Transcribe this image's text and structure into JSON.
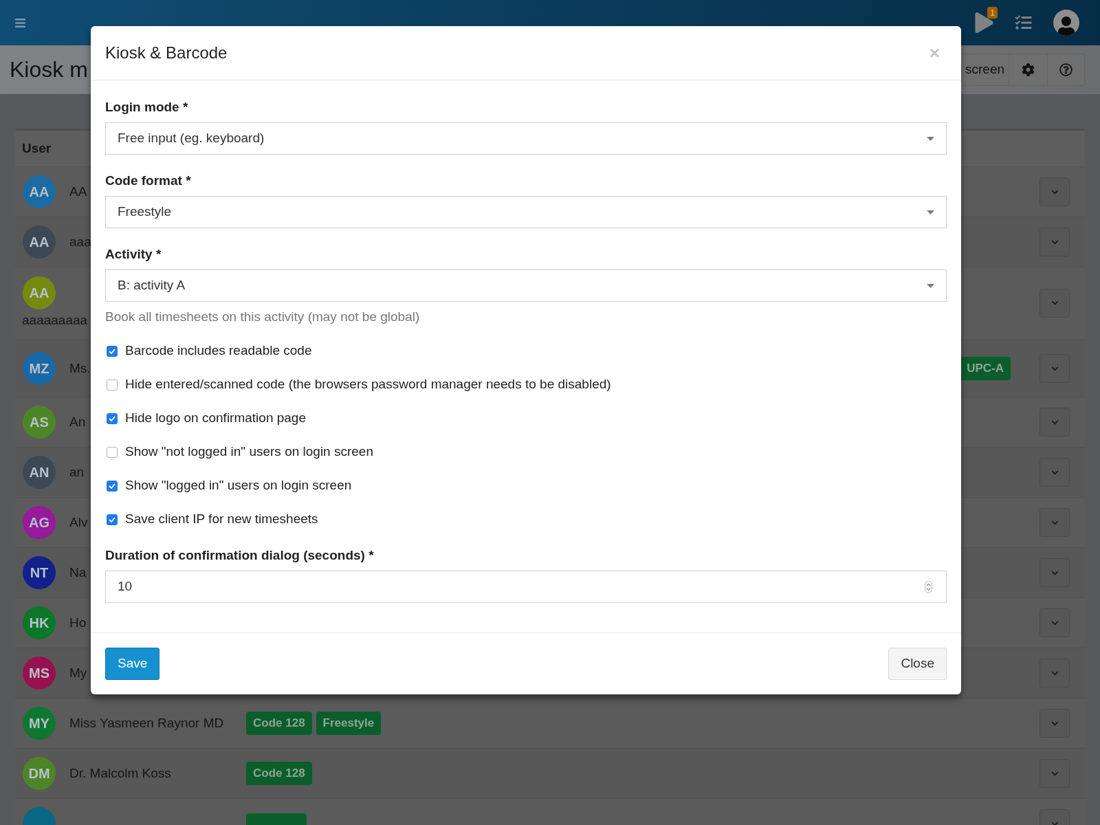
{
  "header": {
    "notification_count": "1"
  },
  "page": {
    "title": "Kiosk m",
    "toolbar_label": "screen"
  },
  "table": {
    "columns": [
      "User"
    ],
    "rows": [
      {
        "kind": "inline",
        "initials": "AA",
        "color": "#1c6ba3",
        "name": "AA"
      },
      {
        "kind": "inline",
        "initials": "AA",
        "color": "#3c4955",
        "name": "aaa"
      },
      {
        "kind": "wrapped",
        "initials": "AA",
        "color": "#778a10",
        "name": "aaaaaaaaa"
      },
      {
        "kind": "inline",
        "initials": "MZ",
        "color": "#1b68a6",
        "name": "Ms.",
        "trailing_badges": [
          "UPC-A"
        ]
      },
      {
        "kind": "inline",
        "initials": "AS",
        "color": "#4d8627",
        "name": "An"
      },
      {
        "kind": "inline",
        "initials": "AN",
        "color": "#3c4955",
        "name": "an"
      },
      {
        "kind": "inline",
        "initials": "AG",
        "color": "#951a9c",
        "name": "Alv"
      },
      {
        "kind": "inline",
        "initials": "NT",
        "color": "#11208a",
        "name": "Na"
      },
      {
        "kind": "inline",
        "initials": "HK",
        "color": "#0b772a",
        "name": "Ho"
      },
      {
        "kind": "inline",
        "initials": "MS",
        "color": "#971150",
        "name": "My"
      },
      {
        "kind": "inline",
        "initials": "MY",
        "color": "#0e7830",
        "name": "Miss Yasmeen Raynor MD",
        "badges": [
          "Code 128",
          "Freestyle"
        ]
      },
      {
        "kind": "inline",
        "initials": "DM",
        "color": "#4d8627",
        "name": "Dr. Malcolm Koss",
        "badges": [
          "Code 128"
        ]
      },
      {
        "kind": "cut",
        "color": "#0b6884"
      }
    ]
  },
  "modal": {
    "title": "Kiosk & Barcode",
    "close_label": "×",
    "fields": [
      {
        "kind": "select",
        "label": "Login mode *",
        "value": "Free input (eg. keyboard)"
      },
      {
        "kind": "select",
        "label": "Code format *",
        "value": "Freestyle"
      },
      {
        "kind": "select",
        "label": "Activity *",
        "value": "B: activity A",
        "help": "Book all timesheets on this activity (may not be global)"
      }
    ],
    "options": [
      {
        "label": "Barcode includes readable code",
        "checked": true
      },
      {
        "label": "Hide entered/scanned code (the browsers password manager needs to be disabled)",
        "checked": false
      },
      {
        "label": "Hide logo on confirmation page",
        "checked": true
      },
      {
        "label": "Show \"not logged in\" users on login screen",
        "checked": false
      },
      {
        "label": "Show \"logged in\" users on login screen",
        "checked": true
      },
      {
        "label": "Save client IP for new timesheets",
        "checked": true
      }
    ],
    "duration": {
      "label": "Duration of confirmation dialog (seconds) *",
      "value": "10"
    },
    "buttons": [
      {
        "kind": "primary",
        "label": "Save"
      },
      {
        "kind": "secondary",
        "label": "Close"
      }
    ]
  }
}
